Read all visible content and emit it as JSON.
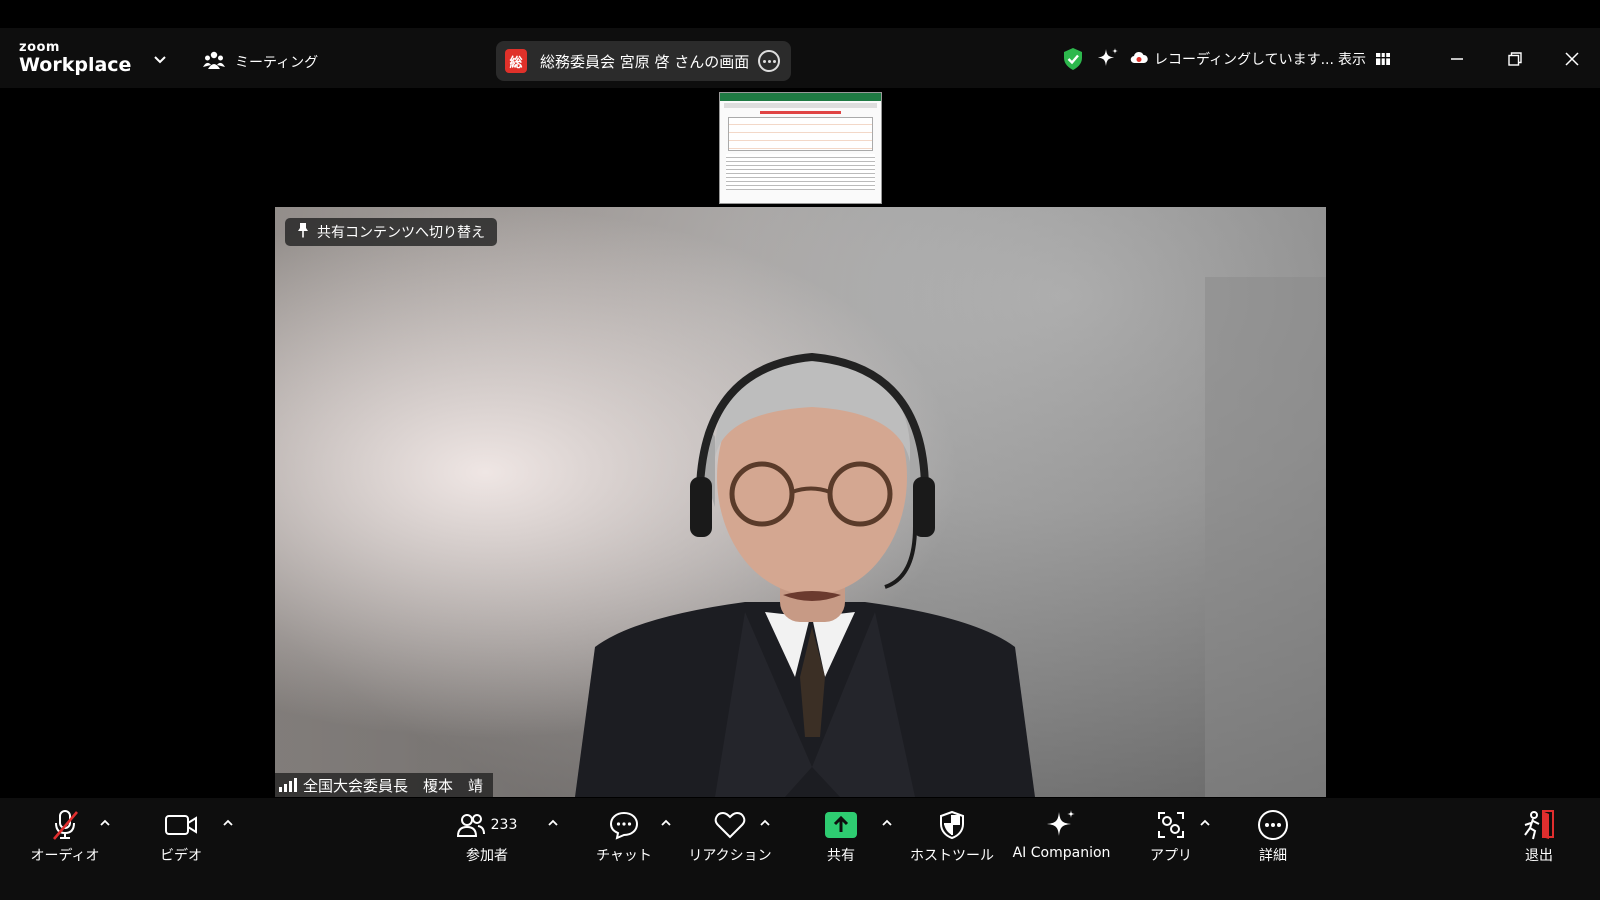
{
  "app": {
    "logo_top": "zoom",
    "logo_bottom": "Workplace"
  },
  "header": {
    "meeting_label": "ミーティング",
    "share_badge": "総",
    "share_title": "総務委員会 宮原 啓 さんの画面",
    "recording_text": "レコーディングしています...",
    "view_label": "表示"
  },
  "video": {
    "switch_label": "共有コンテンツへ切り替え",
    "participant_name": "全国大会委員長　榎本　靖"
  },
  "toolbar": {
    "audio": "オーディオ",
    "video": "ビデオ",
    "participants": "参加者",
    "participants_count": "233",
    "chat": "チャット",
    "reactions": "リアクション",
    "share": "共有",
    "host_tools": "ホストツール",
    "ai_companion": "AI Companion",
    "apps": "アプリ",
    "more": "詳細",
    "leave": "退出"
  },
  "colors": {
    "share_green": "#2ecc71",
    "shield_green": "#2db84d",
    "leave_red": "#e02e2e",
    "badge_red": "#e0312a"
  }
}
